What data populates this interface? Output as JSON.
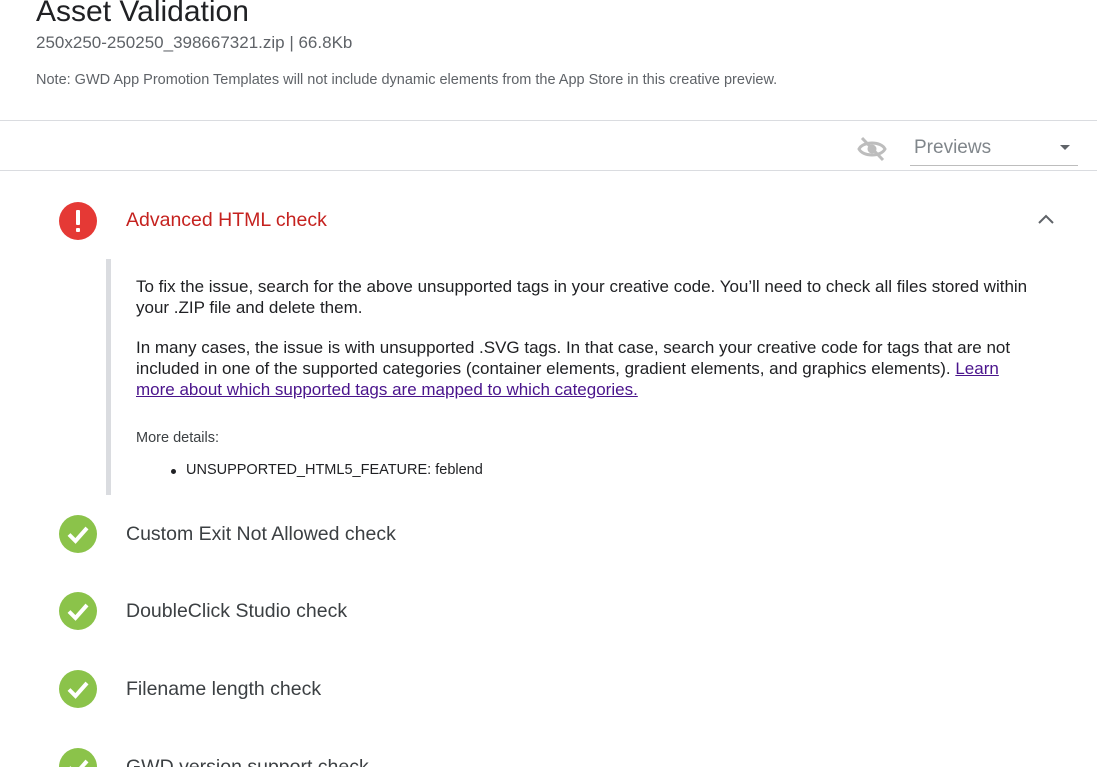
{
  "header": {
    "title": "Asset Validation",
    "subtitle": "250x250-250250_398667321.zip | 66.8Kb",
    "note": "Note: GWD App Promotion Templates will not include dynamic elements from the App Store in this creative preview."
  },
  "toolbar": {
    "visibility_icon": "visibility-off-icon",
    "previews_label": "Previews"
  },
  "checks": [
    {
      "label": "Advanced HTML check",
      "status": "error",
      "expanded": true,
      "details": {
        "paragraph1": "To fix the issue, search for the above unsupported tags in your creative code. You’ll need to check all files stored within your .ZIP file and delete them.",
        "paragraph2_text": "In many cases, the issue is with unsupported .SVG tags. In that case, search your creative code for tags that are not included in one of the supported categories (container elements, gradient elements, and graphics elements).",
        "paragraph2_link": "Learn more about which supported tags are mapped to which categories.",
        "more_details_label": "More details:",
        "items": [
          "UNSUPPORTED_HTML5_FEATURE: feblend"
        ]
      }
    },
    {
      "label": "Custom Exit Not Allowed check",
      "status": "pass"
    },
    {
      "label": "DoubleClick Studio check",
      "status": "pass"
    },
    {
      "label": "Filename length check",
      "status": "pass"
    },
    {
      "label": "GWD version support check",
      "status": "pass"
    }
  ],
  "colors": {
    "error": "#e53935",
    "error_text": "#c5221f",
    "pass": "#8bc34a",
    "link": "#4a148c"
  }
}
